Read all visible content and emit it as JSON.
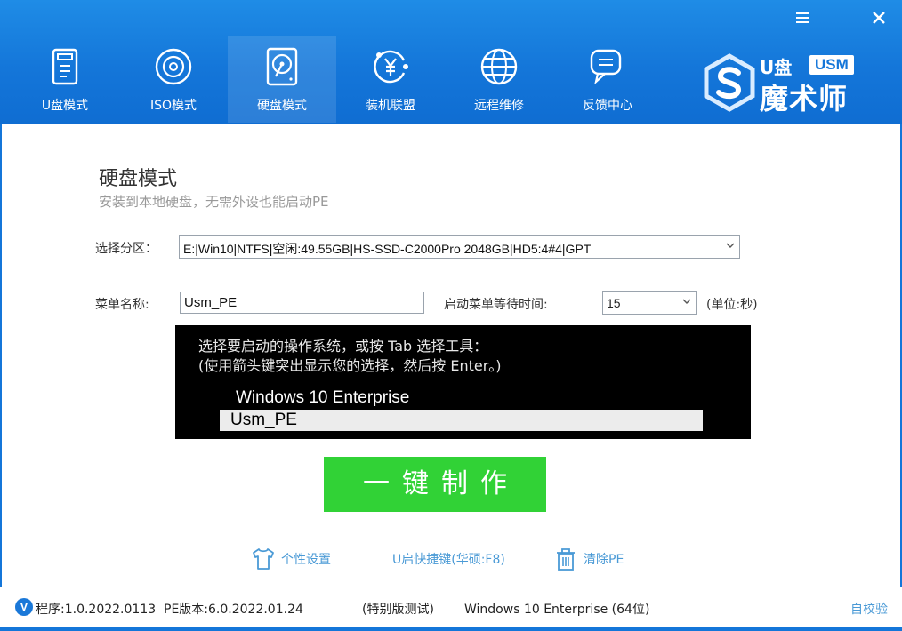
{
  "window": {
    "menu_icon": "menu-icon",
    "close_icon": "close-icon"
  },
  "nav": [
    {
      "label": "U盘模式",
      "icon": "usb-drive-icon",
      "active": false
    },
    {
      "label": "ISO模式",
      "icon": "disc-icon",
      "active": false
    },
    {
      "label": "硬盘模式",
      "icon": "hard-disk-icon",
      "active": true
    },
    {
      "label": "装机联盟",
      "icon": "yen-network-icon",
      "active": false
    },
    {
      "label": "远程维修",
      "icon": "globe-icon",
      "active": false
    },
    {
      "label": "反馈中心",
      "icon": "chat-feedback-icon",
      "active": false
    }
  ],
  "logo": {
    "u_text": "U盘",
    "badge": "USM",
    "name": "魔术师"
  },
  "main": {
    "title": "硬盘模式",
    "subtitle": "安装到本地硬盘，无需外设也能启动PE",
    "partition_label": "选择分区：",
    "partition_value": "E:|Win10|NTFS|空闲:49.55GB|HS-SSD-C2000Pro 2048GB|HD5:4#4|GPT",
    "menu_name_label": "菜单名称:",
    "menu_name_value": "Usm_PE",
    "wait_label": "启动菜单等待时间:",
    "wait_value": "15",
    "wait_unit": "(单位:秒)"
  },
  "preview": {
    "line1": "选择要启动的操作系统，或按 Tab 选择工具：",
    "line2": "(使用箭头键突出显示您的选择，然后按 Enter。)",
    "option1": "Windows 10 Enterprise",
    "option2": "Usm_PE"
  },
  "action": {
    "make_label": "一键制作"
  },
  "tools": {
    "personalize": "个性设置",
    "hotkey": "U启快捷键(华硕:F8)",
    "clear_pe": "清除PE"
  },
  "status": {
    "program": "程序:1.0.2022.0113",
    "pe_version": "PE版本:6.0.2022.01.24",
    "edition": "(特别版测试)",
    "os": "Windows 10 Enterprise (64位)",
    "self_check": "自校验"
  },
  "colors": {
    "header_blue": "#1476d9",
    "make_green": "#31d236",
    "link_blue": "#4a9ad6"
  }
}
